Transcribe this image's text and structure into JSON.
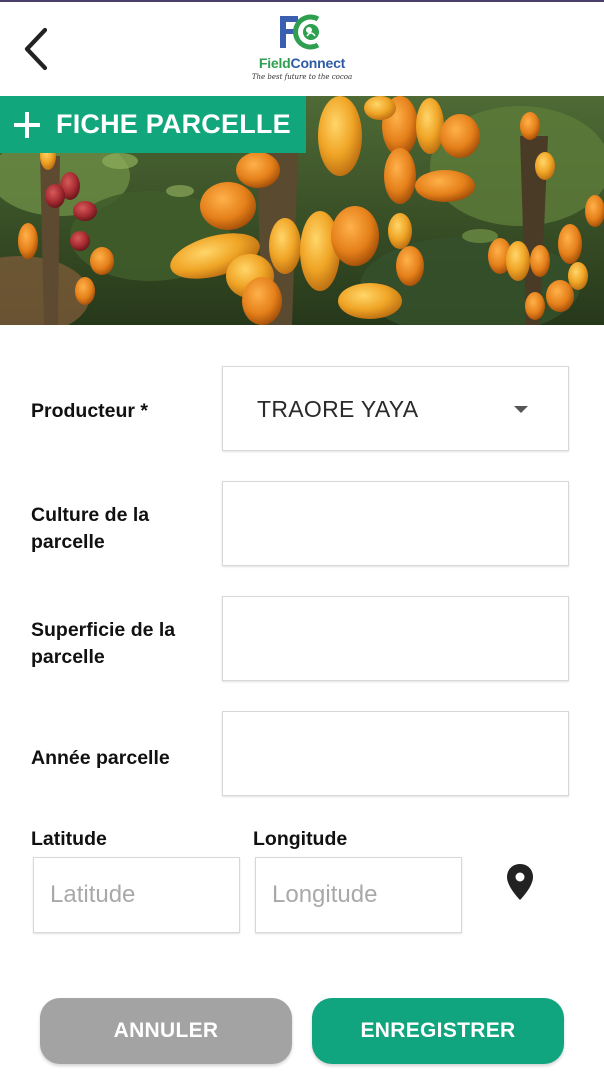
{
  "header": {
    "back_icon": "chevron-left-icon",
    "logo": {
      "mark": "FC",
      "name_part1": "Field",
      "name_part2": "Connect",
      "tagline": "The best future to the cocoa"
    }
  },
  "banner": {
    "title": "FICHE PARCELLE",
    "icon": "plus-icon",
    "image": "cocoa-pods-photo"
  },
  "form": {
    "producer": {
      "label": "Producteur *",
      "value": "TRAORE YAYA",
      "icon": "caret-down-icon"
    },
    "culture": {
      "label": "Culture de la parcelle",
      "value": ""
    },
    "superficie": {
      "label": "Superficie de la parcelle",
      "value": ""
    },
    "annee": {
      "label": "Année parcelle",
      "value": ""
    },
    "latitude": {
      "label": "Latitude",
      "placeholder": "Latitude",
      "value": ""
    },
    "longitude": {
      "label": "Longitude",
      "placeholder": "Longitude",
      "value": ""
    },
    "location_icon": "map-pin-icon"
  },
  "actions": {
    "cancel_label": "ANNULER",
    "save_label": "ENREGISTRER"
  },
  "colors": {
    "accent": "#12a67c",
    "cancel": "#a3a3a3",
    "status_bar": "#4a3f6b"
  }
}
